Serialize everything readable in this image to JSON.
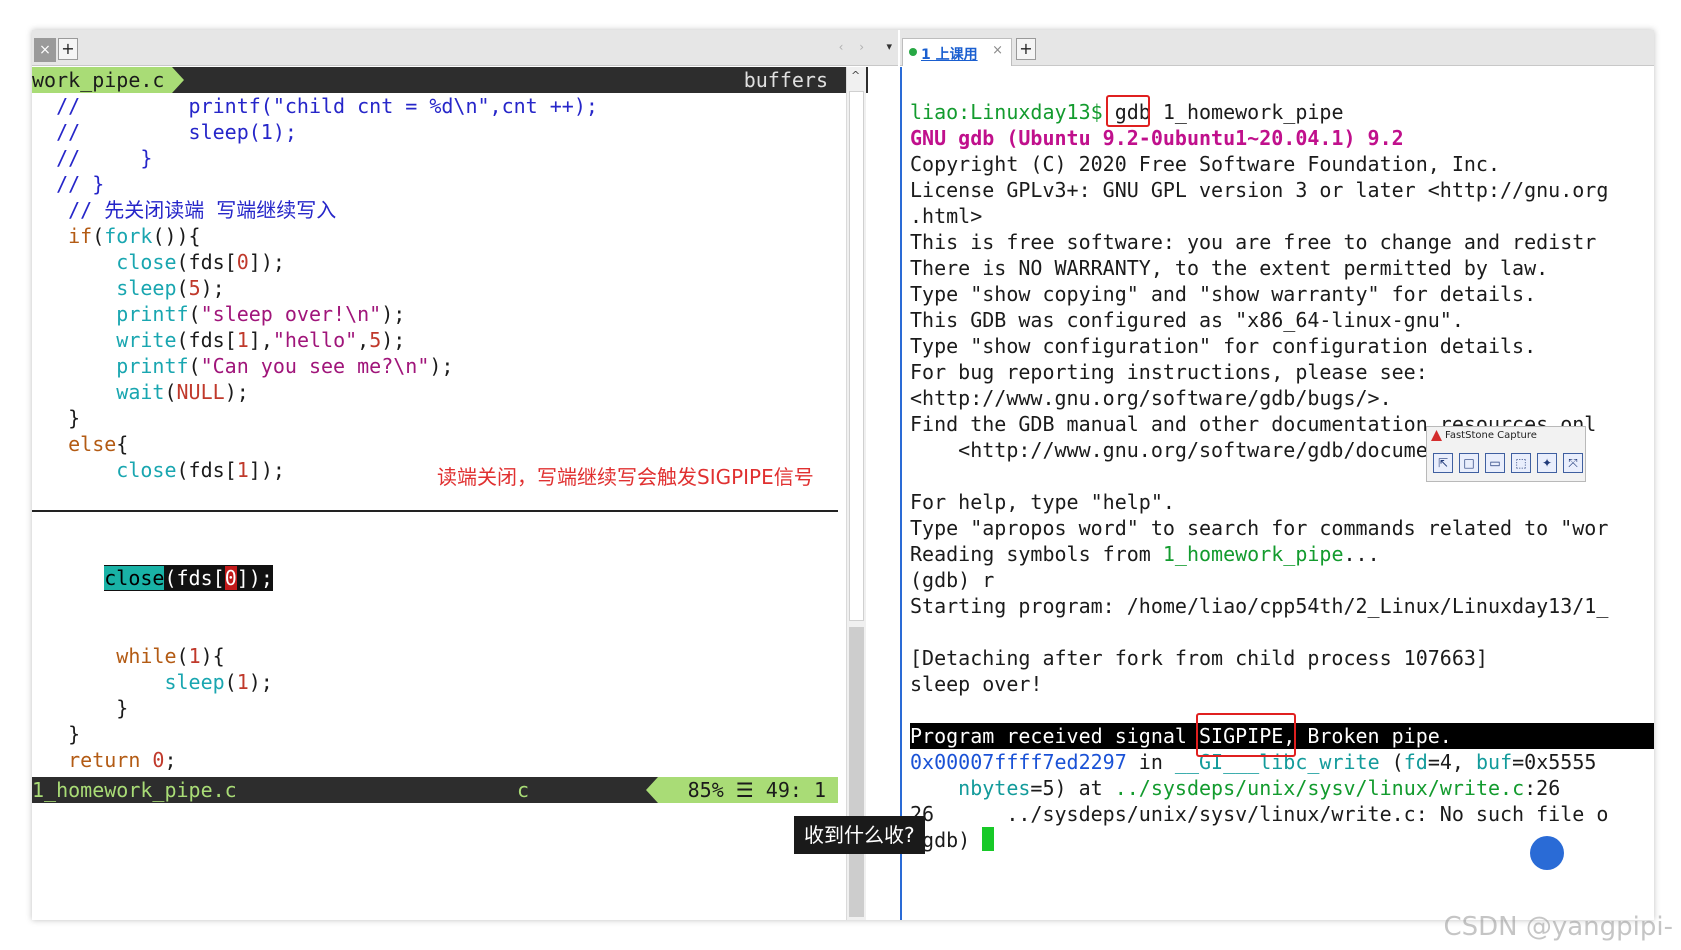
{
  "left_tabstrip": {
    "close_glyph": "×",
    "plus_glyph": "+",
    "nav_glyph": "‹ ›",
    "drop_glyph": "▾"
  },
  "right_tabstrip": {
    "tab_label": "1 上课用",
    "close_glyph": "×",
    "plus_glyph": "+"
  },
  "vim": {
    "tab_title": "work_pipe.c",
    "buffers_label": "buffers",
    "status": {
      "filename": "1_homework_pipe.c",
      "filetype": "c",
      "percent": "85%",
      "menu_glyph": "☰",
      "position": "49:   1"
    },
    "upper_lines": [
      [
        {
          "t": "  //         printf(\"child cnt = %d\\n\",cnt ++);",
          "c": "cm"
        }
      ],
      [
        {
          "t": "  //         sleep(1);",
          "c": "cm"
        }
      ],
      [
        {
          "t": "  //     }",
          "c": "cm"
        }
      ],
      [
        {
          "t": "  // }",
          "c": "cm"
        }
      ],
      [
        {
          "t": "   // 先关闭读端 写端继续写入",
          "c": "cm"
        }
      ],
      [
        {
          "t": "   ",
          "c": "pl"
        },
        {
          "t": "if",
          "c": "kw"
        },
        {
          "t": "(",
          "c": "pl"
        },
        {
          "t": "fork",
          "c": "fn"
        },
        {
          "t": "()){",
          "c": "pl"
        }
      ],
      [
        {
          "t": "       ",
          "c": "pl"
        },
        {
          "t": "close",
          "c": "fn"
        },
        {
          "t": "(fds[",
          "c": "pl"
        },
        {
          "t": "0",
          "c": "num"
        },
        {
          "t": "]);",
          "c": "pl"
        }
      ],
      [
        {
          "t": "       ",
          "c": "pl"
        },
        {
          "t": "sleep",
          "c": "fn"
        },
        {
          "t": "(",
          "c": "pl"
        },
        {
          "t": "5",
          "c": "num"
        },
        {
          "t": ");",
          "c": "pl"
        }
      ],
      [
        {
          "t": "       ",
          "c": "pl"
        },
        {
          "t": "printf",
          "c": "fn"
        },
        {
          "t": "(",
          "c": "pl"
        },
        {
          "t": "\"sleep over!\\n\"",
          "c": "str"
        },
        {
          "t": ");",
          "c": "pl"
        }
      ],
      [
        {
          "t": "       ",
          "c": "pl"
        },
        {
          "t": "write",
          "c": "fn"
        },
        {
          "t": "(fds[",
          "c": "pl"
        },
        {
          "t": "1",
          "c": "num"
        },
        {
          "t": "],",
          "c": "pl"
        },
        {
          "t": "\"hello\"",
          "c": "str"
        },
        {
          "t": ",",
          "c": "pl"
        },
        {
          "t": "5",
          "c": "num"
        },
        {
          "t": ");",
          "c": "pl"
        }
      ],
      [
        {
          "t": "       ",
          "c": "pl"
        },
        {
          "t": "printf",
          "c": "fn"
        },
        {
          "t": "(",
          "c": "pl"
        },
        {
          "t": "\"Can you see me?\\n\"",
          "c": "str"
        },
        {
          "t": ");",
          "c": "pl"
        }
      ],
      [
        {
          "t": "       ",
          "c": "pl"
        },
        {
          "t": "wait",
          "c": "fn"
        },
        {
          "t": "(",
          "c": "pl"
        },
        {
          "t": "NULL",
          "c": "num"
        },
        {
          "t": ");",
          "c": "pl"
        }
      ],
      [
        {
          "t": "   }",
          "c": "pl"
        }
      ],
      [
        {
          "t": "   ",
          "c": "pl"
        },
        {
          "t": "else",
          "c": "kw"
        },
        {
          "t": "{",
          "c": "pl"
        }
      ],
      [
        {
          "t": "       ",
          "c": "pl"
        },
        {
          "t": "close",
          "c": "fn"
        },
        {
          "t": "(fds[",
          "c": "pl"
        },
        {
          "t": "1",
          "c": "num"
        },
        {
          "t": "]);",
          "c": "pl"
        }
      ]
    ],
    "cursor_line": {
      "indent": "      ",
      "fn": "close",
      "open": "(fds[",
      "idx": "0",
      "close": "]);"
    },
    "lower_lines": [
      [
        {
          "t": "       ",
          "c": "pl"
        },
        {
          "t": "while",
          "c": "kw"
        },
        {
          "t": "(",
          "c": "pl"
        },
        {
          "t": "1",
          "c": "num"
        },
        {
          "t": "){",
          "c": "pl"
        }
      ],
      [
        {
          "t": "           ",
          "c": "pl"
        },
        {
          "t": "sleep",
          "c": "fn"
        },
        {
          "t": "(",
          "c": "pl"
        },
        {
          "t": "1",
          "c": "num"
        },
        {
          "t": ");",
          "c": "pl"
        }
      ],
      [
        {
          "t": "       }",
          "c": "pl"
        }
      ],
      [
        {
          "t": "   }",
          "c": "pl"
        }
      ],
      [
        {
          "t": "   ",
          "c": "pl"
        },
        {
          "t": "return",
          "c": "kw"
        },
        {
          "t": " ",
          "c": "pl"
        },
        {
          "t": "0",
          "c": "num"
        },
        {
          "t": ";",
          "c": "pl"
        }
      ]
    ],
    "annotation": "读端关闭，写端继续写会触发SIGPIPE信号"
  },
  "terminal": {
    "lines": [
      [
        {
          "t": "liao:Linuxday13$ ",
          "c": "g"
        },
        {
          "t": "gdb",
          "c": "pl"
        },
        {
          "t": " 1_homework_pipe",
          "c": "pl"
        }
      ],
      [
        {
          "t": "GNU gdb (Ubuntu 9.2-0ubuntu1~20.04.1) 9.2",
          "c": "m"
        }
      ],
      [
        {
          "t": "Copyright (C) 2020 Free Software Foundation, Inc.",
          "c": "pl"
        }
      ],
      [
        {
          "t": "License GPLv3+: GNU GPL version 3 or later <http://gnu.org",
          "c": "pl"
        }
      ],
      [
        {
          "t": ".html>",
          "c": "pl"
        }
      ],
      [
        {
          "t": "This is free software: you are free to change and redistr",
          "c": "pl"
        }
      ],
      [
        {
          "t": "There is NO WARRANTY, to the extent permitted by law.",
          "c": "pl"
        }
      ],
      [
        {
          "t": "Type \"show copying\" and \"show warranty\" for details.",
          "c": "pl"
        }
      ],
      [
        {
          "t": "This GDB was configured as \"x86_64-linux-gnu\".",
          "c": "pl"
        }
      ],
      [
        {
          "t": "Type \"show configuration\" for configuration details.",
          "c": "pl"
        }
      ],
      [
        {
          "t": "For bug reporting instructions, please see:",
          "c": "pl"
        }
      ],
      [
        {
          "t": "<http://www.gnu.org/software/gdb/bugs/>.",
          "c": "pl"
        }
      ],
      [
        {
          "t": "Find the GDB manual and other documentation resources onl",
          "c": "pl"
        }
      ],
      [
        {
          "t": "    <http://www.gnu.org/software/gdb/documentation/>.",
          "c": "pl"
        }
      ],
      [
        {
          "t": "",
          "c": "pl"
        }
      ],
      [
        {
          "t": "For help, type \"help\".",
          "c": "pl"
        }
      ],
      [
        {
          "t": "Type \"apropos word\" to search for commands related to \"wor",
          "c": "pl"
        }
      ],
      [
        {
          "t": "Reading symbols from ",
          "c": "pl"
        },
        {
          "t": "1_homework_pipe",
          "c": "g"
        },
        {
          "t": "...",
          "c": "pl"
        }
      ],
      [
        {
          "t": "(gdb) r",
          "c": "pl"
        }
      ],
      [
        {
          "t": "Starting program: /home/liao/cpp54th/2_Linux/Linuxday13/1_",
          "c": "pl"
        }
      ],
      [
        {
          "t": "",
          "c": "pl"
        }
      ],
      [
        {
          "t": "[Detaching after fork from child process 107663]",
          "c": "pl"
        }
      ],
      [
        {
          "t": "sleep over!",
          "c": "pl"
        }
      ],
      [
        {
          "t": "",
          "c": "pl"
        }
      ]
    ],
    "signal_line": "Program received signal SIGPIPE, Broken pipe.",
    "after_lines": [
      [
        {
          "t": "0x00007ffff7ed2297",
          "c": "b"
        },
        {
          "t": " in ",
          "c": "pl"
        },
        {
          "t": "__GI___libc_write",
          "c": "c"
        },
        {
          "t": " (",
          "c": "pl"
        },
        {
          "t": "fd",
          "c": "c"
        },
        {
          "t": "=4, ",
          "c": "pl"
        },
        {
          "t": "buf",
          "c": "c"
        },
        {
          "t": "=0x5555",
          "c": "pl"
        }
      ],
      [
        {
          "t": "    ",
          "c": "pl"
        },
        {
          "t": "nbytes",
          "c": "c"
        },
        {
          "t": "=5) at ",
          "c": "pl"
        },
        {
          "t": "../sysdeps/unix/sysv/linux/write.c",
          "c": "g"
        },
        {
          "t": ":26",
          "c": "pl"
        }
      ],
      [
        {
          "t": "26      ../sysdeps/unix/sysv/linux/write.c: No such file o",
          "c": "pl"
        }
      ],
      [
        {
          "t": "(gdb) ",
          "c": "pl"
        }
      ]
    ]
  },
  "faststone": {
    "title": "FastStone Capture",
    "buttons": [
      "⇱",
      "□",
      "▭",
      "⬚",
      "✦",
      "⤧"
    ]
  },
  "subtitle": "收到什么收?",
  "watermark": "CSDN @yangpipi-"
}
